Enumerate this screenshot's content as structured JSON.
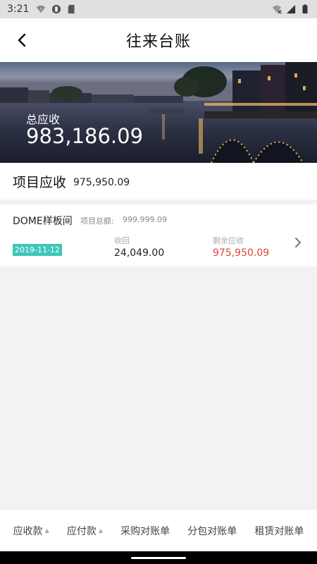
{
  "status_bar": {
    "time": "3:21",
    "left_icons": [
      "wifi-question-icon",
      "app-notification-icon",
      "sd-card-icon"
    ],
    "right_icons": [
      "wifi-off-icon",
      "signal-icon",
      "battery-icon"
    ]
  },
  "header": {
    "title": "往来台账",
    "back_icon": "back-arrow-icon"
  },
  "banner": {
    "label": "总应收",
    "value": "983,186.09"
  },
  "summary": {
    "label": "项目应收",
    "value": "975,950.09"
  },
  "project_card": {
    "name": "DOME样板间",
    "total_label": "项目总额:",
    "total_value": "999,999.09",
    "date": "2019-11-12",
    "received_label": "收回",
    "received_value": "24,049.00",
    "remaining_label": "剩余应收",
    "remaining_value": "975,950.09",
    "colors": {
      "badge": "#3ec6b8",
      "remaining": "#e0453a"
    }
  },
  "bottom_nav": {
    "items": [
      {
        "label": "应收款",
        "icon": "sort-up-icon"
      },
      {
        "label": "应付款",
        "icon": "sort-up-icon"
      },
      {
        "label": "采购对账单"
      },
      {
        "label": "分包对账单"
      },
      {
        "label": "租赁对账单"
      }
    ]
  }
}
